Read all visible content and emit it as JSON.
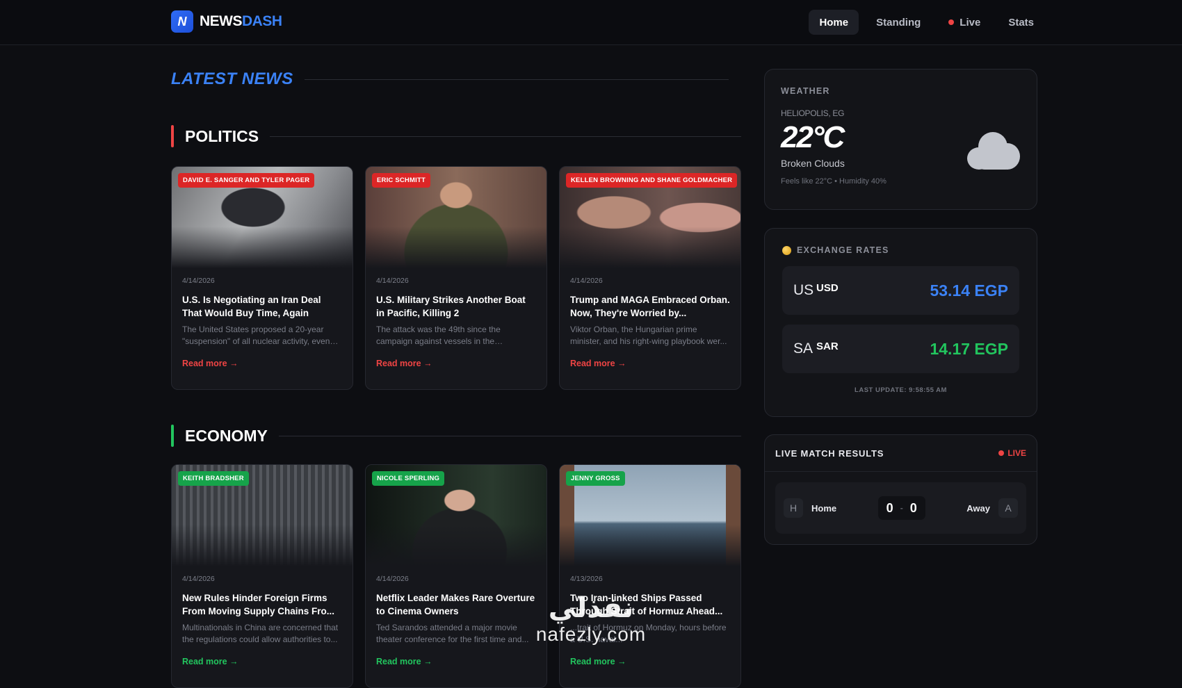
{
  "brand": {
    "name_part1": "NEWS",
    "name_part2": "DASH",
    "mark": "N"
  },
  "nav": [
    {
      "label": "Home",
      "active": true
    },
    {
      "label": "Standing",
      "active": false
    },
    {
      "label": "Live",
      "active": false,
      "indicator": "red-dot"
    },
    {
      "label": "Stats",
      "active": false
    }
  ],
  "page_heading": "LATEST NEWS",
  "sections": [
    {
      "title": "POLITICS",
      "accent": "#ef4444",
      "articles": [
        {
          "author": "DAVID E. SANGER AND TYLER PAGER",
          "date": "4/14/2026",
          "title": "U.S. Is Negotiating an Iran Deal That Would Buy Time, Again",
          "summary": "The United States proposed a 20-year \"suspension\" of all nuclear activity, even a...",
          "link": "Read more →"
        },
        {
          "author": "ERIC SCHMITT",
          "date": "4/14/2026",
          "title": "U.S. Military Strikes Another Boat in Pacific, Killing 2",
          "summary": "The attack was the 49th since the campaign against vessels in the Caribbea...",
          "link": "Read more →"
        },
        {
          "author": "KELLEN BROWNING AND SHANE GOLDMACHER",
          "date": "4/14/2026",
          "title": "Trump and MAGA Embraced Orban. Now, They're Worried by...",
          "summary": "Viktor Orban, the Hungarian prime minister, and his right-wing playbook wer...",
          "link": "Read more →"
        }
      ]
    },
    {
      "title": "ECONOMY",
      "accent": "#22c55e",
      "articles": [
        {
          "author": "KEITH BRADSHER",
          "date": "4/14/2026",
          "title": "New Rules Hinder Foreign Firms From Moving Supply Chains Fro...",
          "summary": "Multinationals in China are concerned that the regulations could allow authorities to...",
          "link": "Read more →"
        },
        {
          "author": "NICOLE SPERLING",
          "date": "4/14/2026",
          "title": "Netflix Leader Makes Rare Overture to Cinema Owners",
          "summary": "Ted Sarandos attended a major movie theater conference for the first time and...",
          "link": "Read more →"
        },
        {
          "author": "JENNY GROSS",
          "date": "4/13/2026",
          "title": "Two Iran-linked Ships Passed Through Strait of Hormuz Ahead...",
          "summary": "...trait of Hormuz on Monday, hours before a U.S. naval...",
          "link": "Read more →"
        }
      ]
    }
  ],
  "weather": {
    "label": "WEATHER",
    "location": "HELIOPOLIS, EG",
    "temperature": "22°C",
    "condition": "Broken Clouds",
    "details": "Feels like 22°C • Humidity 40%",
    "icon": "cloud-icon"
  },
  "exchange": {
    "label": "EXCHANGE RATES",
    "icon": "coins-icon",
    "rates": [
      {
        "flag": "US",
        "code": "USD",
        "value": "53.14 EGP",
        "color": "#3b82f6"
      },
      {
        "flag": "SA",
        "code": "SAR",
        "value": "14.17 EGP",
        "color": "#22c55e"
      }
    ],
    "last_update": "LAST UPDATE: 9:58:55 AM"
  },
  "match": {
    "label": "LIVE MATCH RESULTS",
    "live_label": "LIVE",
    "home_initial": "H",
    "home_name": "Home",
    "home_score": "0",
    "separator": "-",
    "away_score": "0",
    "away_name": "Away",
    "away_initial": "A"
  },
  "watermark": {
    "arabic": "نفذلي",
    "latin": "nafezly.com"
  }
}
